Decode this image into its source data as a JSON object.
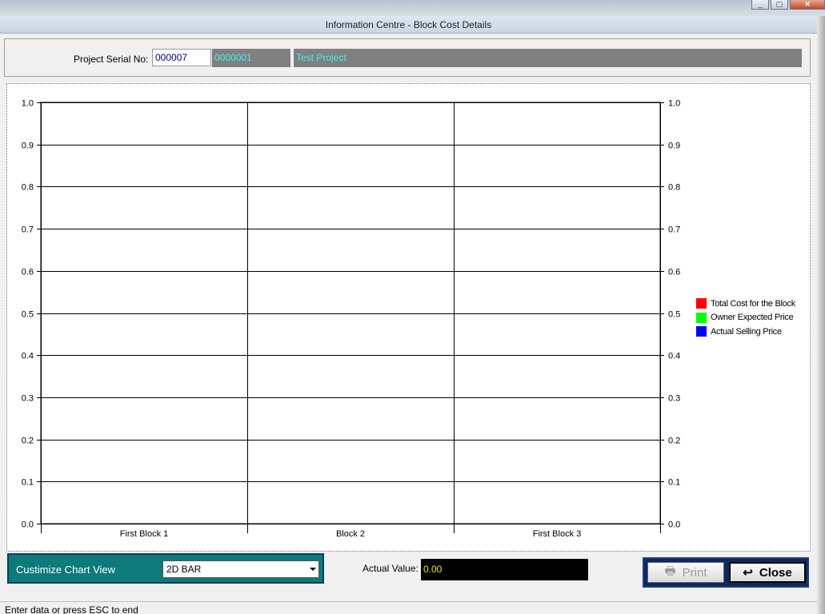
{
  "window": {
    "title": "Information Centre - Block Cost Details",
    "controls": [
      "minimize",
      "restore",
      "close"
    ]
  },
  "header": {
    "serial_label": "Project Serial No:",
    "serial_value": "000007",
    "project_code": "0000001",
    "project_name": "Test Project"
  },
  "chart_data": {
    "type": "bar",
    "title": "",
    "categories": [
      "First Block 1",
      "Block 2",
      "First Block 3"
    ],
    "series": [
      {
        "name": "Total Cost for the Block",
        "color": "#ff0000",
        "values": [
          0,
          0,
          0
        ]
      },
      {
        "name": "Owner Expected Price",
        "color": "#00ff00",
        "values": [
          0,
          0,
          0
        ]
      },
      {
        "name": "Actual Selling Price",
        "color": "#0000ff",
        "values": [
          0,
          0,
          0
        ]
      }
    ],
    "ylim": [
      0,
      1.0
    ],
    "yticks": [
      "0.0",
      "0.1",
      "0.2",
      "0.3",
      "0.4",
      "0.5",
      "0.6",
      "0.7",
      "0.8",
      "0.9",
      "1.0"
    ],
    "grid": true,
    "legend_position": "right",
    "xlabel": "",
    "ylabel": ""
  },
  "controls": {
    "customize_label": "Custimize Chart View",
    "chart_type": "2D BAR",
    "actual_value_label": "Actual Value:",
    "actual_value": "0.00"
  },
  "buttons": {
    "print": "Print",
    "close": "Close"
  },
  "status": "Enter data or press ESC to end"
}
